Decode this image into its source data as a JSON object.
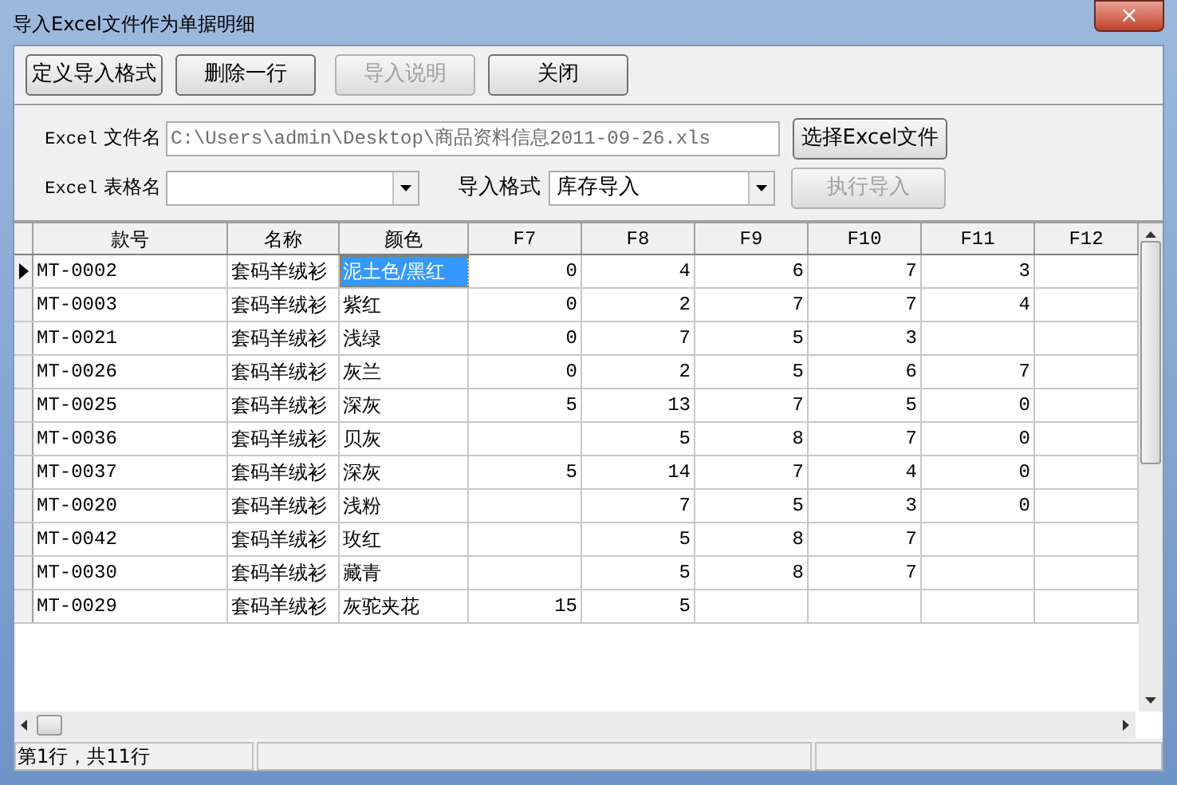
{
  "window": {
    "title": "导入Excel文件作为单据明细",
    "close": "×"
  },
  "toolbar": [
    {
      "label": "定义导入格式",
      "disabled": false
    },
    {
      "label": "删除一行",
      "disabled": false
    },
    {
      "label": "导入说明",
      "disabled": true
    },
    {
      "label": "关闭",
      "disabled": false
    }
  ],
  "file": {
    "label_prefix": "Excel",
    "label": "文件名",
    "value": "C:\\Users\\admin\\Desktop\\商品资料信息2011-09-26.xls",
    "button": "选择Excel文件"
  },
  "sheet": {
    "label_prefix": "Excel",
    "label": "表格名",
    "format_label": "导入格式",
    "format_value": "库存导入",
    "run_button": {
      "label": "执行导入",
      "disabled": true
    }
  },
  "grid": {
    "columns": [
      {
        "label": "款号",
        "current": false
      },
      {
        "label": "名称",
        "current": false
      },
      {
        "label": "颜色",
        "current": true
      },
      {
        "label": "F7",
        "current": false
      },
      {
        "label": "F8",
        "current": false
      },
      {
        "label": "F9",
        "current": false
      },
      {
        "label": "F10",
        "current": false
      },
      {
        "label": "F11",
        "current": false
      },
      {
        "label": "F12",
        "current": false
      }
    ],
    "rows": [
      {
        "selected": true,
        "cells": [
          "MT-0002",
          "套码羊绒衫",
          "泥土色/黑红",
          "0",
          "4",
          "6",
          "7",
          "3",
          ""
        ]
      },
      {
        "selected": false,
        "cells": [
          "MT-0003",
          "套码羊绒衫",
          "紫红",
          "0",
          "2",
          "7",
          "7",
          "4",
          ""
        ]
      },
      {
        "selected": false,
        "cells": [
          "MT-0021",
          "套码羊绒衫",
          "浅绿",
          "0",
          "7",
          "5",
          "3",
          "",
          ""
        ]
      },
      {
        "selected": false,
        "cells": [
          "MT-0026",
          "套码羊绒衫",
          "灰兰",
          "0",
          "2",
          "5",
          "6",
          "7",
          ""
        ]
      },
      {
        "selected": false,
        "cells": [
          "MT-0025",
          "套码羊绒衫",
          "深灰",
          "5",
          "13",
          "7",
          "5",
          "0",
          ""
        ]
      },
      {
        "selected": false,
        "cells": [
          "MT-0036",
          "套码羊绒衫",
          "贝灰",
          "",
          "5",
          "8",
          "7",
          "0",
          ""
        ]
      },
      {
        "selected": false,
        "cells": [
          "MT-0037",
          "套码羊绒衫",
          "深灰",
          "5",
          "14",
          "7",
          "4",
          "0",
          ""
        ]
      },
      {
        "selected": false,
        "cells": [
          "MT-0020",
          "套码羊绒衫",
          "浅粉",
          "",
          "7",
          "5",
          "3",
          "0",
          ""
        ]
      },
      {
        "selected": false,
        "cells": [
          "MT-0042",
          "套码羊绒衫",
          "玫红",
          "",
          "5",
          "8",
          "7",
          "",
          ""
        ]
      },
      {
        "selected": false,
        "cells": [
          "MT-0030",
          "套码羊绒衫",
          "藏青",
          "",
          "5",
          "8",
          "7",
          "",
          ""
        ]
      },
      {
        "selected": false,
        "cells": [
          "MT-0029",
          "套码羊绒衫",
          "灰驼夹花",
          "15",
          "5",
          "",
          "",
          "",
          ""
        ]
      }
    ]
  },
  "status_bar": [
    "第1行，共11行"
  ]
}
